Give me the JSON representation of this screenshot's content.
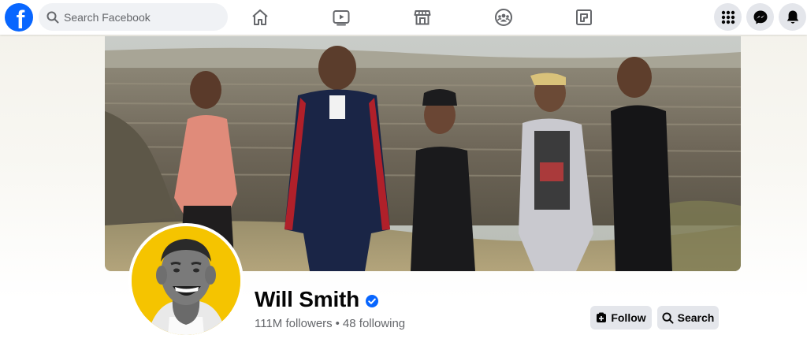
{
  "topbar": {
    "logo": {
      "icon": "facebook-logo",
      "glyph": "f",
      "color": "#0866ff"
    },
    "search": {
      "placeholder": "Search Facebook",
      "icon": "search-icon"
    },
    "nav": [
      {
        "name": "home",
        "icon": "home-icon"
      },
      {
        "name": "watch",
        "icon": "video-play-icon"
      },
      {
        "name": "marketplace",
        "icon": "marketplace-store-icon"
      },
      {
        "name": "groups",
        "icon": "groups-icon"
      },
      {
        "name": "gaming",
        "icon": "gaming-icon"
      }
    ],
    "actions": [
      {
        "name": "menu",
        "icon": "grid-menu-icon"
      },
      {
        "name": "messenger",
        "icon": "messenger-icon"
      },
      {
        "name": "notifications",
        "icon": "bell-icon"
      }
    ]
  },
  "profile": {
    "name": "Will Smith",
    "verified": true,
    "followers": "111M followers",
    "separator": "•",
    "following": "48 following",
    "accent_color": "#0866ff"
  },
  "buttons": {
    "follow_label": "Follow",
    "follow_icon": "follow-add-icon",
    "search_label": "Search",
    "search_icon": "search-icon"
  }
}
